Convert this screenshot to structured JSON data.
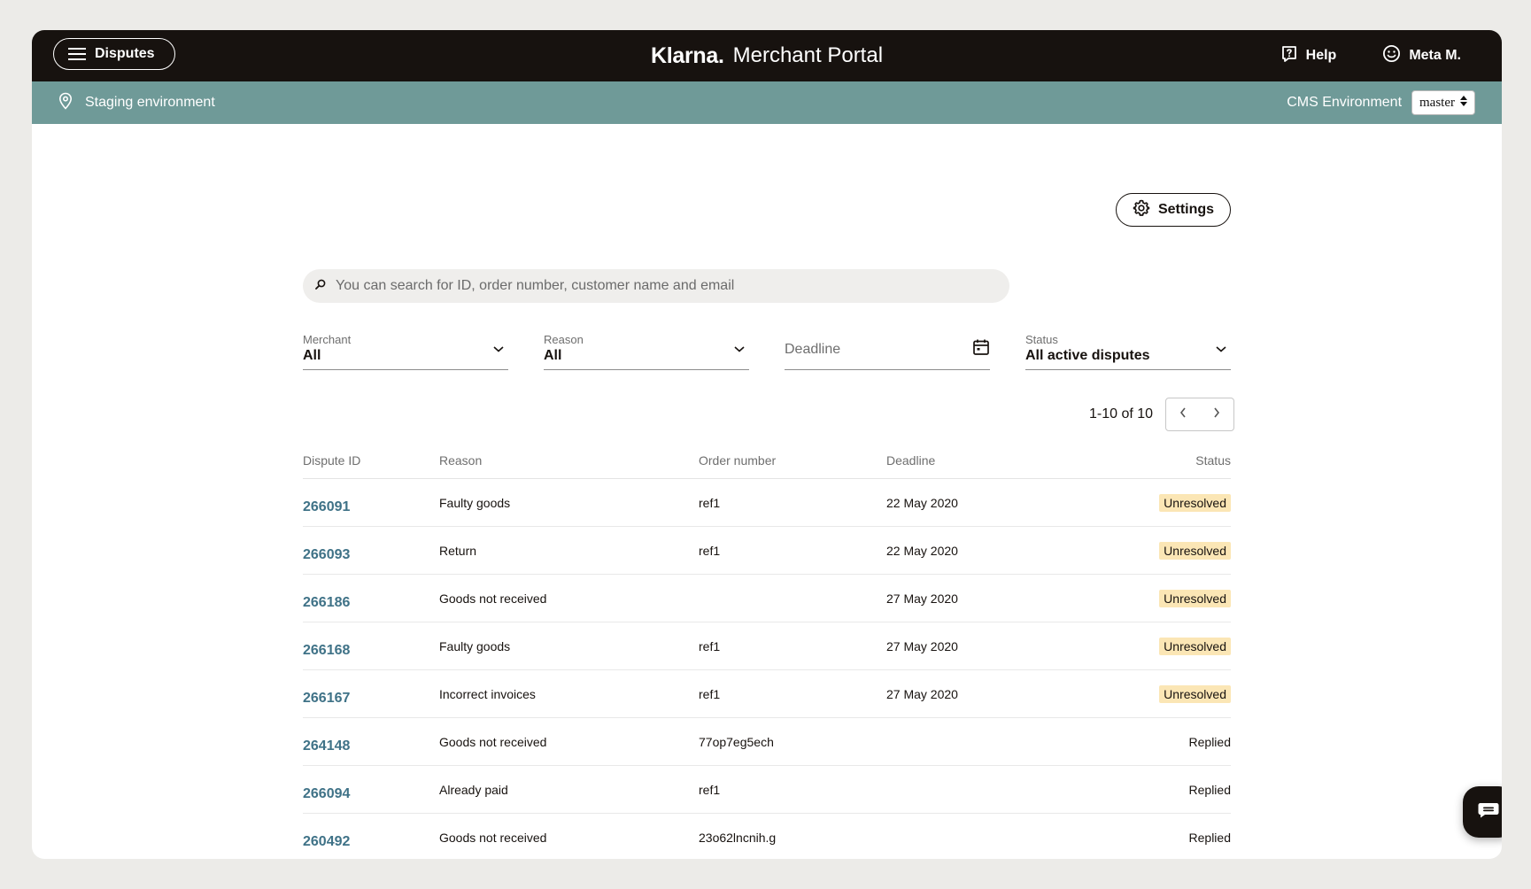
{
  "header": {
    "menu_label": "Disputes",
    "brand_logo": "Klarna.",
    "brand_title": "Merchant Portal",
    "help_label": "Help",
    "user_label": "Meta M."
  },
  "environment": {
    "label": "Staging environment",
    "cms_label": "CMS Environment",
    "cms_value": "master"
  },
  "toolbar": {
    "settings_label": "Settings"
  },
  "search": {
    "placeholder": "You can search for ID, order number, customer name and email"
  },
  "filters": {
    "merchant": {
      "label": "Merchant",
      "value": "All"
    },
    "reason": {
      "label": "Reason",
      "value": "All"
    },
    "deadline": {
      "placeholder": "Deadline"
    },
    "status": {
      "label": "Status",
      "value": "All active disputes"
    }
  },
  "pagination": {
    "range": "1-10 of 10"
  },
  "table": {
    "columns": [
      "Dispute ID",
      "Reason",
      "Order number",
      "Deadline",
      "Status"
    ],
    "rows": [
      {
        "id": "266091",
        "reason": "Faulty goods",
        "order": "ref1",
        "deadline": "22 May 2020",
        "status": "Unresolved"
      },
      {
        "id": "266093",
        "reason": "Return",
        "order": "ref1",
        "deadline": "22 May 2020",
        "status": "Unresolved"
      },
      {
        "id": "266186",
        "reason": "Goods not received",
        "order": "",
        "deadline": "27 May 2020",
        "status": "Unresolved"
      },
      {
        "id": "266168",
        "reason": "Faulty goods",
        "order": "ref1",
        "deadline": "27 May 2020",
        "status": "Unresolved"
      },
      {
        "id": "266167",
        "reason": "Incorrect invoices",
        "order": "ref1",
        "deadline": "27 May 2020",
        "status": "Unresolved"
      },
      {
        "id": "264148",
        "reason": "Goods not received",
        "order": "77op7eg5ech",
        "deadline": "",
        "status": "Replied"
      },
      {
        "id": "266094",
        "reason": "Already paid",
        "order": "ref1",
        "deadline": "",
        "status": "Replied"
      },
      {
        "id": "260492",
        "reason": "Goods not received",
        "order": "23o62lncnih.g",
        "deadline": "",
        "status": "Replied"
      }
    ]
  },
  "colors": {
    "topbar": "#17120f",
    "env_bar": "#6f9a98",
    "link": "#3f7287",
    "badge_unresolved": "#fbe6b5"
  },
  "icons": [
    "menu-icon",
    "help-icon",
    "smiley-icon",
    "location-pin-icon",
    "sort-arrows-icon",
    "gear-icon",
    "search-icon",
    "chevron-down-icon",
    "calendar-icon",
    "chevron-left-icon",
    "chevron-right-icon",
    "chat-icon"
  ]
}
